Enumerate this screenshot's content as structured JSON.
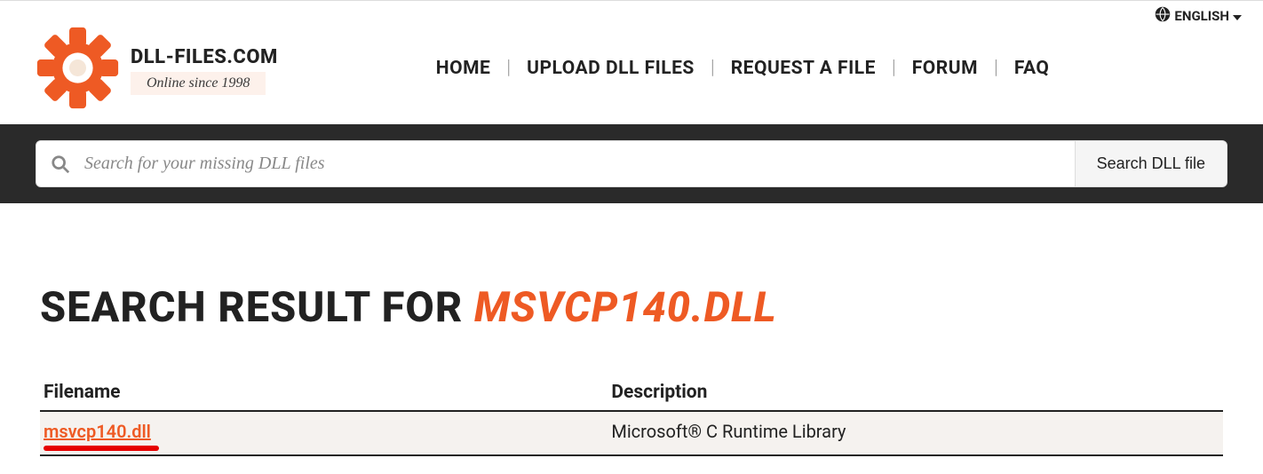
{
  "lang": {
    "label": "ENGLISH"
  },
  "brand": {
    "name": "DLL-FILES.COM",
    "tagline": "Online since 1998"
  },
  "nav": {
    "home": "HOME",
    "upload": "UPLOAD DLL FILES",
    "request": "REQUEST A FILE",
    "forum": "FORUM",
    "faq": "FAQ"
  },
  "search": {
    "placeholder": "Search for your missing DLL files",
    "button": "Search DLL file"
  },
  "results": {
    "heading_prefix": "SEARCH RESULT FOR ",
    "heading_query": "MSVCP140.DLL",
    "columns": {
      "filename": "Filename",
      "description": "Description"
    },
    "rows": [
      {
        "filename": "msvcp140.dll",
        "description": "Microsoft® C Runtime Library"
      }
    ]
  }
}
